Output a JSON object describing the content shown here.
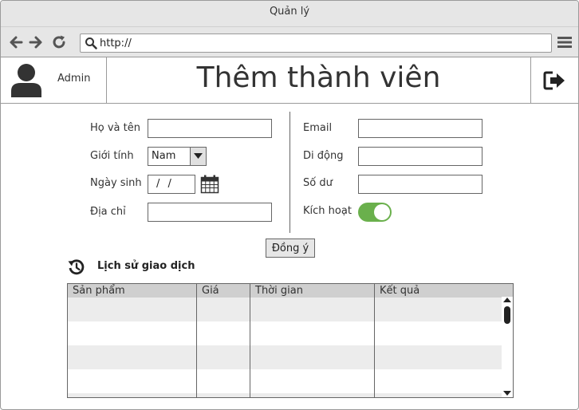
{
  "window": {
    "title": "Quản lý"
  },
  "toolbar": {
    "url": "http://"
  },
  "header": {
    "user_name": "Admin",
    "page_title": "Thêm thành viên"
  },
  "form": {
    "fullname_label": "Họ và tên",
    "fullname_value": "",
    "gender_label": "Giới tính",
    "gender_value": "Nam",
    "dob_label": "Ngày sinh",
    "dob_value": "/ /",
    "address_label": "Địa chỉ",
    "address_value": "",
    "email_label": "Email",
    "email_value": "",
    "phone_label": "Di động",
    "phone_value": "",
    "balance_label": "Số dư",
    "balance_value": "",
    "active_label": "Kích hoạt",
    "active_on": true,
    "submit_label": "Đồng ý"
  },
  "history": {
    "title": "Lịch sử giao dịch",
    "columns": [
      "Sản phẩm",
      "Giá",
      "Thời gian",
      "Kết quả"
    ]
  },
  "colors": {
    "toggle_on": "#6ab04c",
    "chrome": "#e6e6e6",
    "table_header": "#cfcfcf"
  }
}
